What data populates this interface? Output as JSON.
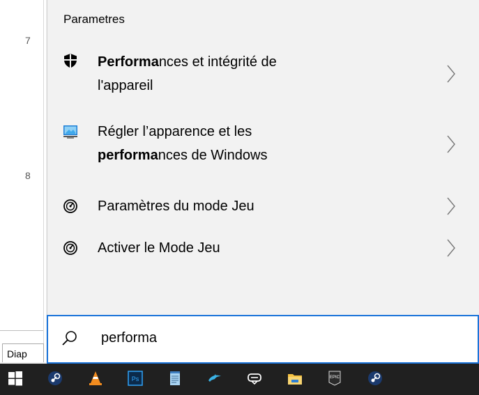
{
  "background_app": {
    "row_numbers": [
      "7",
      "8"
    ],
    "tab_label": "Diap"
  },
  "search_results": {
    "section_title": "Parametres",
    "items": [
      {
        "icon": "shield-icon",
        "line1_highlight": "Performa",
        "line1_rest": "nces et intégrité de",
        "line2": "l'appareil"
      },
      {
        "icon": "monitor-icon",
        "line1": "Régler l’apparence et les",
        "line2_highlight": "performa",
        "line2_rest": "nces de Windows"
      },
      {
        "icon": "game-mode-icon",
        "text": "Paramètres du mode Jeu"
      },
      {
        "icon": "game-mode-icon",
        "text": "Activer le Mode Jeu"
      }
    ]
  },
  "search_box": {
    "value": "performa",
    "accent_color": "#1a73d9"
  },
  "taskbar": {
    "items": [
      "windows-start-icon",
      "steam-icon",
      "vlc-icon",
      "photoshop-icon",
      "notepad-icon",
      "dolphin-icon",
      "vr-headset-icon",
      "file-explorer-icon",
      "epic-games-icon",
      "steam-icon"
    ],
    "photoshop_label": "Ps",
    "epic_label": "EPIC"
  }
}
